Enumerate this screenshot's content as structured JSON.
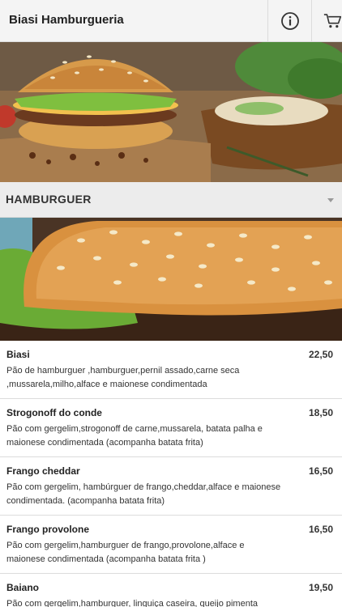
{
  "header": {
    "title": "Biasi Hamburgueria",
    "info_icon": "info-icon",
    "cart_icon": "cart-icon"
  },
  "hero": {
    "image": "burger-hero-photo"
  },
  "category": {
    "title": "HAMBURGUER",
    "image": "burger-closeup-photo"
  },
  "items": [
    {
      "name": "Biasi",
      "price": "22,50",
      "description": "Pão de hamburguer ,hamburguer,pernil assado,carne seca ,mussarela,milho,alface e maionese condimentada"
    },
    {
      "name": "Strogonoff do conde",
      "price": "18,50",
      "description": "Pão com gergelim,strogonoff de carne,mussarela, batata palha e maionese condimentada (acompanha batata frita)"
    },
    {
      "name": "Frango cheddar",
      "price": "16,50",
      "description": "Pão com gergelim, hambúrguer de frango,cheddar,alface e maionese condimentada. (acompanha batata frita)"
    },
    {
      "name": "Frango provolone",
      "price": "16,50",
      "description": "Pão com gergelim,hamburguer de frango,provolone,alface e maionese condimentada (acompanha batata frita )"
    },
    {
      "name": "Baiano",
      "price": "19,50",
      "description": "Pão com gergelim,hamburguer, linguiça caseira, queijo pimenta"
    }
  ]
}
